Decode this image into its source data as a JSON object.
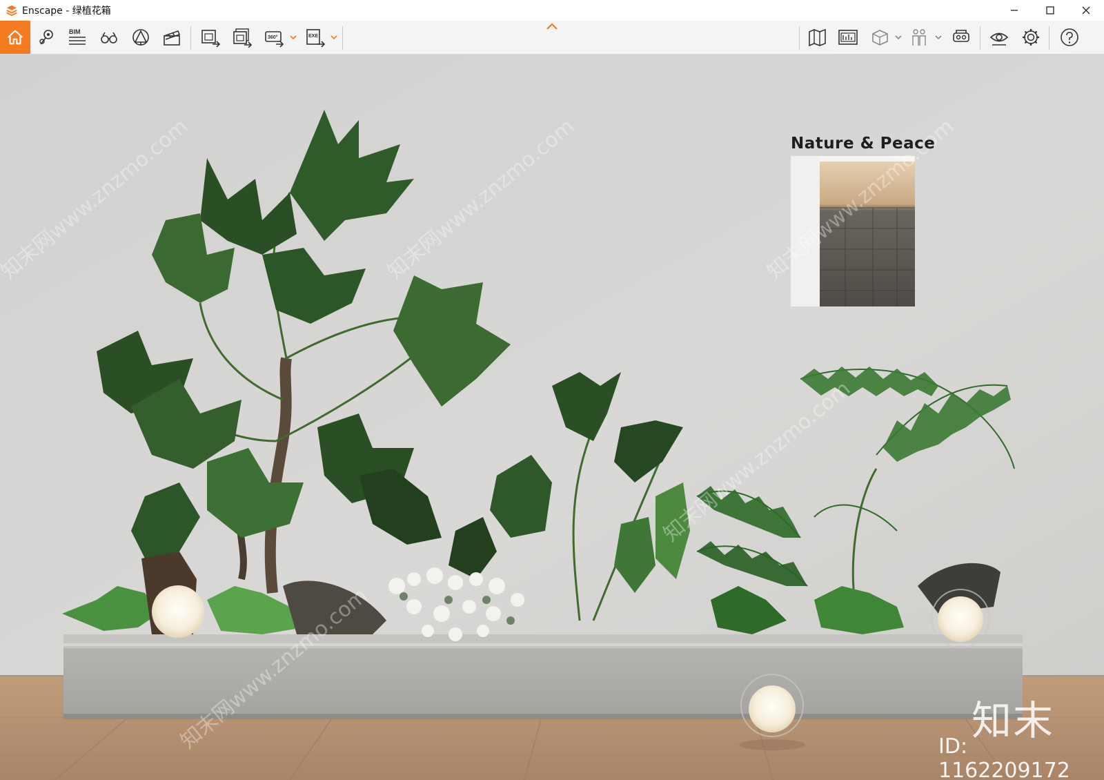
{
  "window": {
    "title": "Enscape - 绿植花箱",
    "controls": [
      "minimize-icon",
      "maximize-icon",
      "close-icon"
    ]
  },
  "toolbar": {
    "left_tools": [
      {
        "name": "home",
        "icon": "home-icon",
        "active": true
      },
      {
        "name": "views",
        "icon": "map-pin-icon"
      },
      {
        "name": "bim",
        "icon": "bim-icon",
        "label": "BIM"
      },
      {
        "name": "atmosphere",
        "icon": "binoculars-icon"
      },
      {
        "name": "asset-library",
        "icon": "asset-icon"
      },
      {
        "name": "video-editor",
        "icon": "clapperboard-icon"
      },
      {
        "name": "render-screenshot",
        "icon": "screenshot-export-icon"
      },
      {
        "name": "batch-render",
        "icon": "batch-render-icon"
      },
      {
        "name": "panorama",
        "icon": "panorama-icon",
        "label": "360°"
      },
      {
        "name": "export-exe",
        "icon": "exe-export-icon",
        "label": "EXE"
      }
    ],
    "right_tools": [
      {
        "name": "map",
        "icon": "map-icon"
      },
      {
        "name": "minimap",
        "icon": "minimap-icon"
      },
      {
        "name": "cube",
        "icon": "cube-icon"
      },
      {
        "name": "people",
        "icon": "people-icon"
      },
      {
        "name": "vr-headset",
        "icon": "vr-headset-icon"
      },
      {
        "name": "visual-settings",
        "icon": "eye-icon"
      },
      {
        "name": "settings",
        "icon": "gear-icon"
      },
      {
        "name": "help",
        "icon": "help-icon"
      }
    ],
    "accent": "#f47b20"
  },
  "viewport": {
    "sign_text": "Nature & Peace",
    "watermark_logo": "知末",
    "watermark_id": "ID: 1162209172",
    "watermark_diagonal": "知末网www.znzmo.com"
  }
}
